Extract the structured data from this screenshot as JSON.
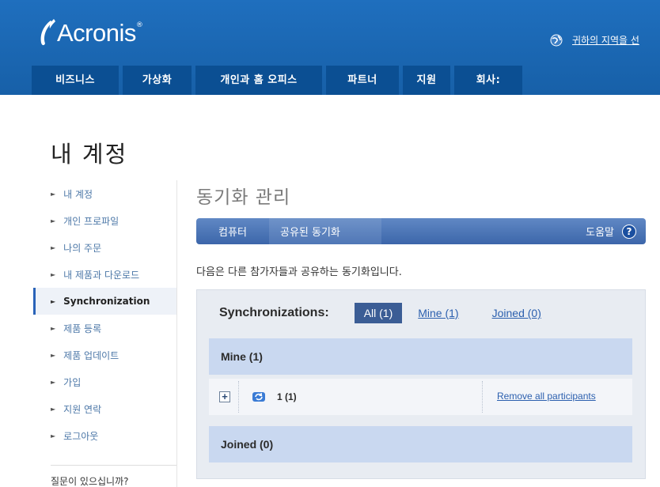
{
  "header": {
    "logo_text": "Acronis",
    "logo_mark": "®",
    "region_link": "귀하의 지역을 선",
    "nav": [
      "비즈니스",
      "가상화",
      "개인과 홈 오피스",
      "파트너",
      "지원",
      "회사:"
    ]
  },
  "page_title": "내 계정",
  "sidebar": {
    "items": [
      {
        "label": "내 계정"
      },
      {
        "label": "개인 프로파일"
      },
      {
        "label": "나의 주문"
      },
      {
        "label": "내 제품과 다운로드"
      },
      {
        "label": "Synchronization"
      },
      {
        "label": "제품 등록"
      },
      {
        "label": "제품 업데이트"
      },
      {
        "label": "가입"
      },
      {
        "label": "지원 연락"
      },
      {
        "label": "로그아웃"
      }
    ],
    "question": "질문이 있으십니까?"
  },
  "main": {
    "title": "동기화 관리",
    "tabs": [
      "컴퓨터",
      "공유된 동기화"
    ],
    "help_label": "도움말",
    "help_icon": "?",
    "description": "다음은 다른 참가자들과 공유하는 동기화입니다.",
    "panel": {
      "title": "Synchronizations:",
      "filters": [
        "All (1)",
        "Mine (1)",
        "Joined (0)"
      ],
      "mine_header": "Mine (1)",
      "row": {
        "expand": "+",
        "label": "1 (1)",
        "action": "Remove all participants"
      },
      "joined_header": "Joined (0)"
    }
  },
  "colors": {
    "header_blue": "#1b67b4",
    "nav_tab": "#0b4f93",
    "subtab_bar": "#4a72b3",
    "group_header": "#c9d8f0",
    "link": "#2b5fae"
  }
}
